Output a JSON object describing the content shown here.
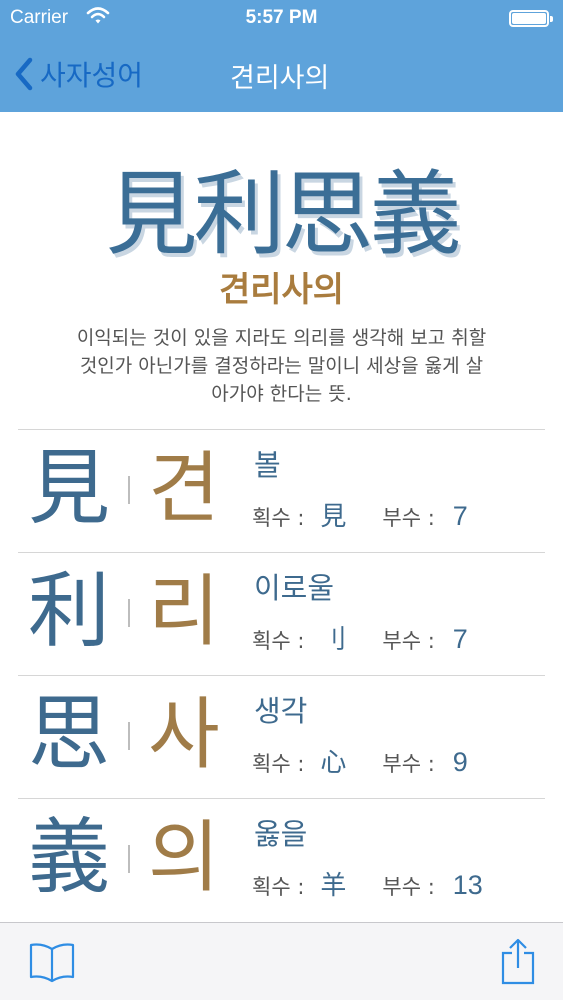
{
  "status": {
    "carrier": "Carrier",
    "time": "5:57 PM"
  },
  "nav": {
    "back_label": "사자성어",
    "title": "견리사의"
  },
  "idiom": {
    "hanja": "見利思義",
    "reading": "견리사의",
    "meaning_lines": [
      "이익되는 것이 있을 지라도 의리를 생각해 보고 취할",
      "것인가 아닌가를 결정하라는 말이니 세상을 옳게 살",
      "아가야 한다는 뜻."
    ]
  },
  "labels": {
    "radical": "획수 :",
    "strokes": "부수 :"
  },
  "characters": [
    {
      "hanja": "見",
      "hangul": "견",
      "gloss": "볼",
      "radical": "見",
      "strokes": "7"
    },
    {
      "hanja": "利",
      "hangul": "리",
      "gloss": "이로울",
      "radical": "刂",
      "strokes": "7"
    },
    {
      "hanja": "思",
      "hangul": "사",
      "gloss": "생각",
      "radical": "心",
      "strokes": "9"
    },
    {
      "hanja": "義",
      "hangul": "의",
      "gloss": "옳을",
      "radical": "羊",
      "strokes": "13"
    }
  ],
  "icons": {
    "back": "chevron-left-icon",
    "book": "book-icon",
    "share": "share-icon"
  },
  "colors": {
    "nav": "#5ea3db",
    "hanja": "#3e6a8e",
    "hangul": "#a07c48"
  }
}
